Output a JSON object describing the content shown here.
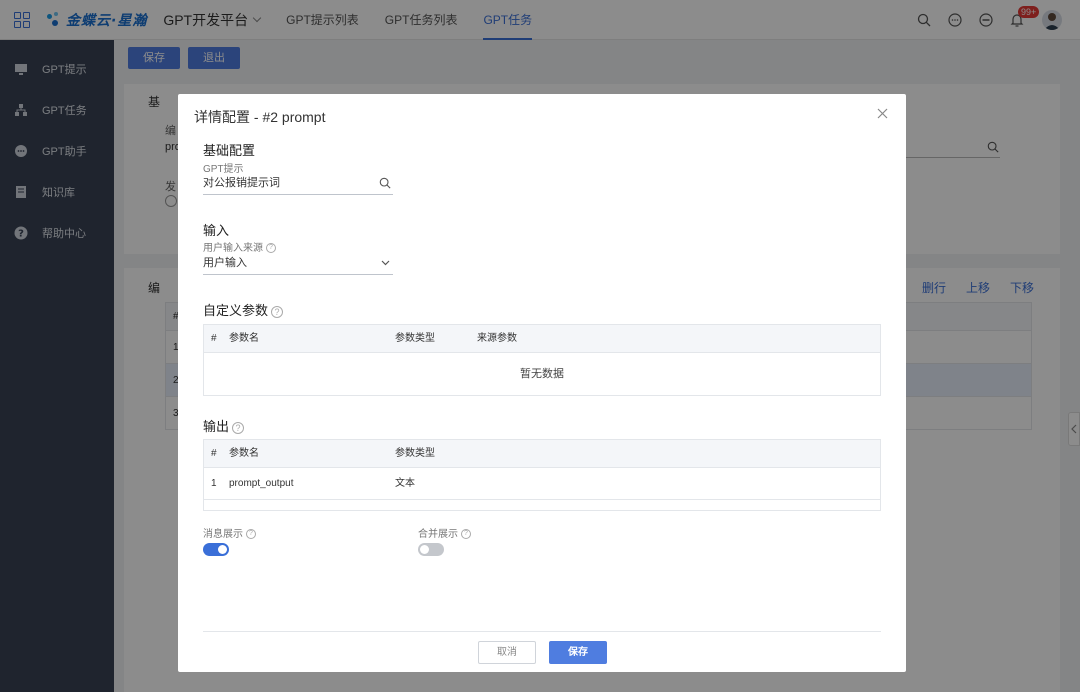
{
  "topbar": {
    "brand": "金蝶云·星瀚",
    "platform": "GPT开发平台",
    "tabs": [
      {
        "label": "GPT提示列表"
      },
      {
        "label": "GPT任务列表"
      },
      {
        "label": "GPT任务"
      }
    ],
    "notification_badge": "99+"
  },
  "sidebar": {
    "items": [
      {
        "label": "GPT提示"
      },
      {
        "label": "GPT任务"
      },
      {
        "label": "GPT助手"
      },
      {
        "label": "知识库"
      },
      {
        "label": "帮助中心"
      }
    ]
  },
  "background": {
    "save_label": "保存",
    "exit_label": "退出",
    "section1": "基",
    "field_label_1": "编",
    "field_value_1": "pro",
    "field_label_2": "发",
    "section2": "编",
    "row_hash": "#",
    "rows": [
      "1",
      "2",
      "3"
    ],
    "actions": {
      "delete": "删行",
      "up": "上移",
      "down": "下移"
    }
  },
  "modal": {
    "title": "详情配置 - #2 prompt",
    "basic": {
      "title": "基础配置",
      "gpt_prompt_label": "GPT提示",
      "gpt_prompt_value": "对公报销提示词"
    },
    "input": {
      "title": "输入",
      "source_label": "用户输入来源",
      "source_value": "用户输入"
    },
    "custom_params": {
      "title": "自定义参数",
      "columns": {
        "hash": "#",
        "name": "参数名",
        "type": "参数类型",
        "source": "来源参数"
      },
      "empty_text": "暂无数据"
    },
    "output": {
      "title": "输出",
      "columns": {
        "hash": "#",
        "name": "参数名",
        "type": "参数类型"
      },
      "rows": [
        {
          "index": "1",
          "name": "prompt_output",
          "type": "文本"
        }
      ]
    },
    "message_display": {
      "label": "消息展示",
      "on": true
    },
    "merge_display": {
      "label": "合并展示",
      "on": false
    },
    "cancel_label": "取消",
    "save_label": "保存"
  },
  "colors": {
    "accent": "#4f7de0",
    "sidebar": "#3a4354",
    "switch_on": "#3a6fd8",
    "switch_off": "#c4c7cc"
  },
  "icons": {
    "apps": "grid-icon",
    "search": "search-icon",
    "chat": "chat-icon",
    "message": "message-icon",
    "bell": "bell-icon",
    "close": "close-icon",
    "help": "help-icon",
    "chevron": "chevron-down-icon"
  }
}
